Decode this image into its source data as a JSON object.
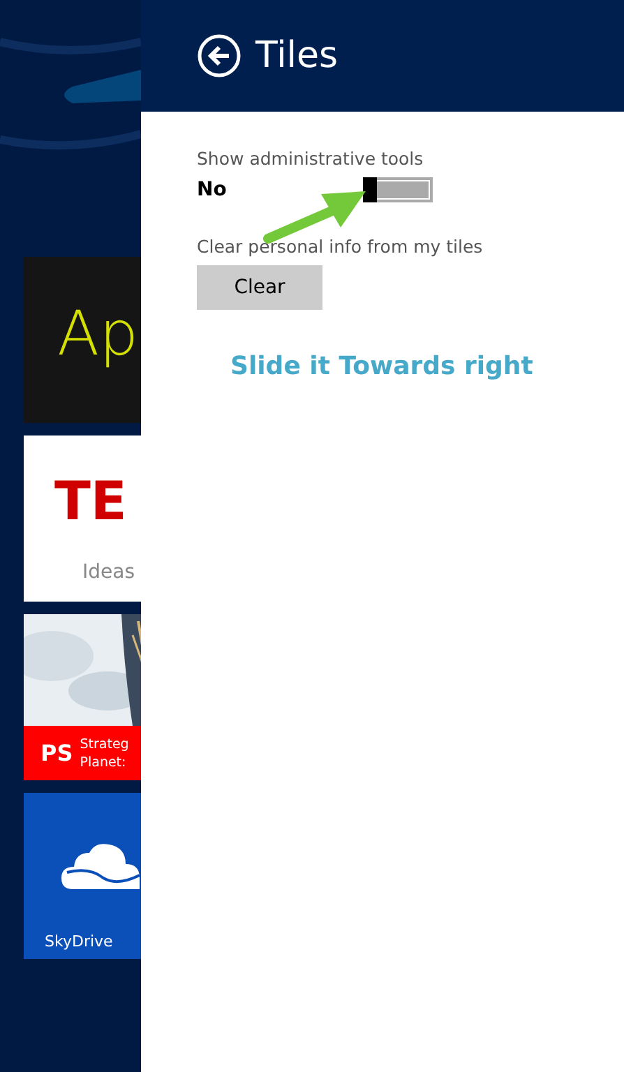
{
  "start_tiles": [
    {
      "kind": "app",
      "label": "Ap"
    },
    {
      "kind": "ted",
      "label": "TE",
      "caption": "Ideas"
    },
    {
      "kind": "ps",
      "label": "PS",
      "lines": [
        "Strateg",
        "Planet:"
      ]
    },
    {
      "kind": "skydrive",
      "label": "SkyDrive"
    }
  ],
  "panel": {
    "title": "Tiles",
    "settings": [
      {
        "kind": "toggle",
        "label": "Show administrative tools",
        "value": "No",
        "on": false
      },
      {
        "kind": "button",
        "label": "Clear personal info from my tiles",
        "button": "Clear"
      }
    ]
  },
  "annotation": {
    "text": "Slide it Towards right"
  }
}
